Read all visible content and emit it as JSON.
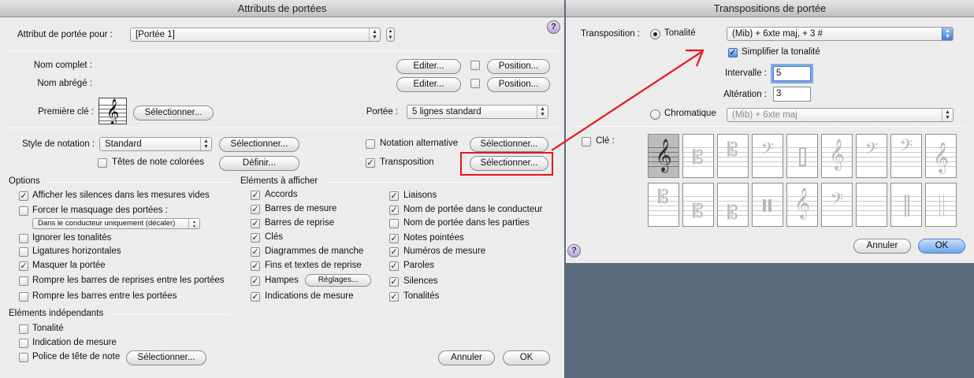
{
  "left": {
    "title": "Attributs de portées",
    "attr_label": "Attribut de portée pour :",
    "attr_value": "[Portée 1]",
    "full_name_label": "Nom complet :",
    "short_name_label": "Nom abrégé :",
    "edit_label": "Editer...",
    "position_label": "Position...",
    "first_clef_label": "Première clé :",
    "select_label": "Sélectionner...",
    "staff_label": "Portée :",
    "staff_value": "5 lignes standard",
    "notation_style_label": "Style de notation :",
    "notation_style_value": "Standard",
    "alt_notation_label": "Notation alternative",
    "colored_heads_label": "Têtes de note colorées",
    "define_label": "Définir...",
    "transposition_label": "Transposition",
    "options_header": "Options",
    "options": [
      {
        "label": "Afficher les silences dans les mesures vides",
        "checked": true
      },
      {
        "label": "Forcer le masquage des portées :",
        "checked": false
      },
      {
        "label": "Ignorer les tonalités",
        "checked": false
      },
      {
        "label": "Ligatures horizontales",
        "checked": false
      },
      {
        "label": "Masquer la portée",
        "checked": true
      },
      {
        "label": "Rompre les barres de reprises entre les portées",
        "checked": false
      },
      {
        "label": "Rompre les barres entre les portées",
        "checked": false
      }
    ],
    "hide_mode_value": "Dans le conducteur uniquement (décaler)",
    "independent_header": "Eléments indépendants",
    "independent": [
      {
        "label": "Tonalité",
        "checked": false
      },
      {
        "label": "Indication de mesure",
        "checked": false
      },
      {
        "label": "Police de tête de note",
        "checked": false
      }
    ],
    "display_header": "Eléments à afficher",
    "display_col1": [
      {
        "label": "Accords",
        "checked": true
      },
      {
        "label": "Barres de mesure",
        "checked": true
      },
      {
        "label": "Barres de reprise",
        "checked": true
      },
      {
        "label": "Clés",
        "checked": true
      },
      {
        "label": "Diagrammes de manche",
        "checked": true
      },
      {
        "label": "Fins et textes de reprise",
        "checked": true
      },
      {
        "label": "Hampes",
        "checked": true
      },
      {
        "label": "Indications de mesure",
        "checked": true
      }
    ],
    "settings_label": "Réglages...",
    "display_col2": [
      {
        "label": "Liaisons",
        "checked": true
      },
      {
        "label": "Nom de portée dans le conducteur",
        "checked": true
      },
      {
        "label": "Nom de portée dans les parties",
        "checked": false
      },
      {
        "label": "Notes pointées",
        "checked": true
      },
      {
        "label": "Numéros de mesure",
        "checked": true
      },
      {
        "label": "Paroles",
        "checked": true
      },
      {
        "label": "Silences",
        "checked": true
      },
      {
        "label": "Tonalités",
        "checked": true
      }
    ],
    "cancel_label": "Annuler",
    "ok_label": "OK"
  },
  "right": {
    "title": "Transpositions de portée",
    "transposition_label": "Transposition :",
    "key_label": "Tonalité",
    "key_value": "(Mib) + 6xte maj, + 3 #",
    "simplify_label": "Simplifier la tonalité",
    "interval_label": "Intervalle :",
    "interval_value": "5",
    "alteration_label": "Altération :",
    "alteration_value": "3",
    "chromatic_label": "Chromatique",
    "chromatic_value": "(Mib) + 6xte maj",
    "clef_label": "Clé :",
    "cancel_label": "Annuler",
    "ok_label": "OK"
  },
  "icons": {
    "help": "?",
    "treble_clef": "𝄞",
    "bass_clef": "𝄢",
    "alto_clef": "𝄡"
  },
  "colors": {
    "annotation_red": "#e8141c",
    "focus_blue": "#7fa9e8"
  }
}
